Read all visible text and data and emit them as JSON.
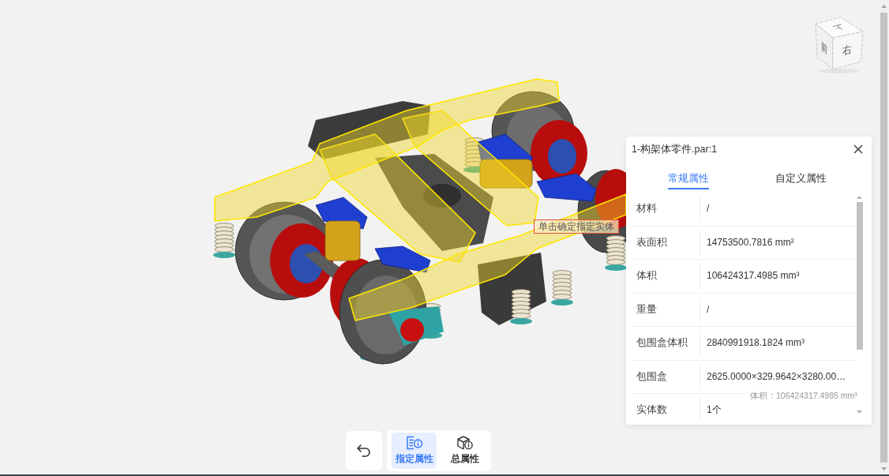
{
  "view_cube": {
    "faces": [
      {
        "kind": "top",
        "label": "上"
      },
      {
        "kind": "front",
        "label": "前"
      },
      {
        "kind": "right",
        "label": "右"
      }
    ]
  },
  "viewport": {
    "hint_tooltip": "单击确定指定实体",
    "fading_tooltip": "体积：106424317.4985 mm³"
  },
  "property_panel": {
    "title": "1-构架体零件.par:1",
    "tabs": [
      {
        "label": "常规属性",
        "selected": true
      },
      {
        "label": "自定义属性",
        "selected": false
      }
    ],
    "rows": [
      {
        "name": "材料",
        "value": "/"
      },
      {
        "name": "表面积",
        "value": "14753500.7816 mm²"
      },
      {
        "name": "体积",
        "value": "106424317.4985 mm³"
      },
      {
        "name": "重量",
        "value": "/"
      },
      {
        "name": "包围盒体积",
        "value": "2840991918.1824 mm³"
      },
      {
        "name": "包围盒",
        "value": "2625.0000×329.9642×3280.00…"
      },
      {
        "name": "实体数",
        "value": "1个"
      }
    ]
  },
  "toolbar": {
    "buttons": [
      {
        "kind": "part_properties",
        "label": "指定属性",
        "selected": true
      },
      {
        "kind": "total_properties",
        "label": "总属性",
        "selected": false
      }
    ]
  }
}
